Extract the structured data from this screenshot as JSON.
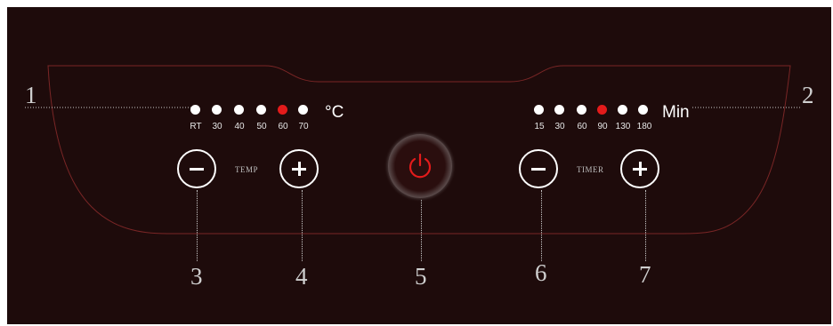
{
  "temperature": {
    "levels": [
      "RT",
      "30",
      "40",
      "50",
      "60",
      "70"
    ],
    "active_index": 4,
    "unit": "°C",
    "label": "TEMP"
  },
  "timer": {
    "levels": [
      "15",
      "30",
      "60",
      "90",
      "130",
      "180"
    ],
    "active_index": 3,
    "unit": "Min",
    "label": "TIMER"
  },
  "callouts": [
    "1",
    "2",
    "3",
    "4",
    "5",
    "6",
    "7"
  ],
  "icons": {
    "minus": "minus-icon",
    "plus": "plus-icon",
    "power": "power-icon"
  },
  "colors": {
    "panel": "#1e0b0b",
    "active_indicator": "#e31b1b",
    "indicator": "#ffffff",
    "outline": "#8a2a2a"
  }
}
